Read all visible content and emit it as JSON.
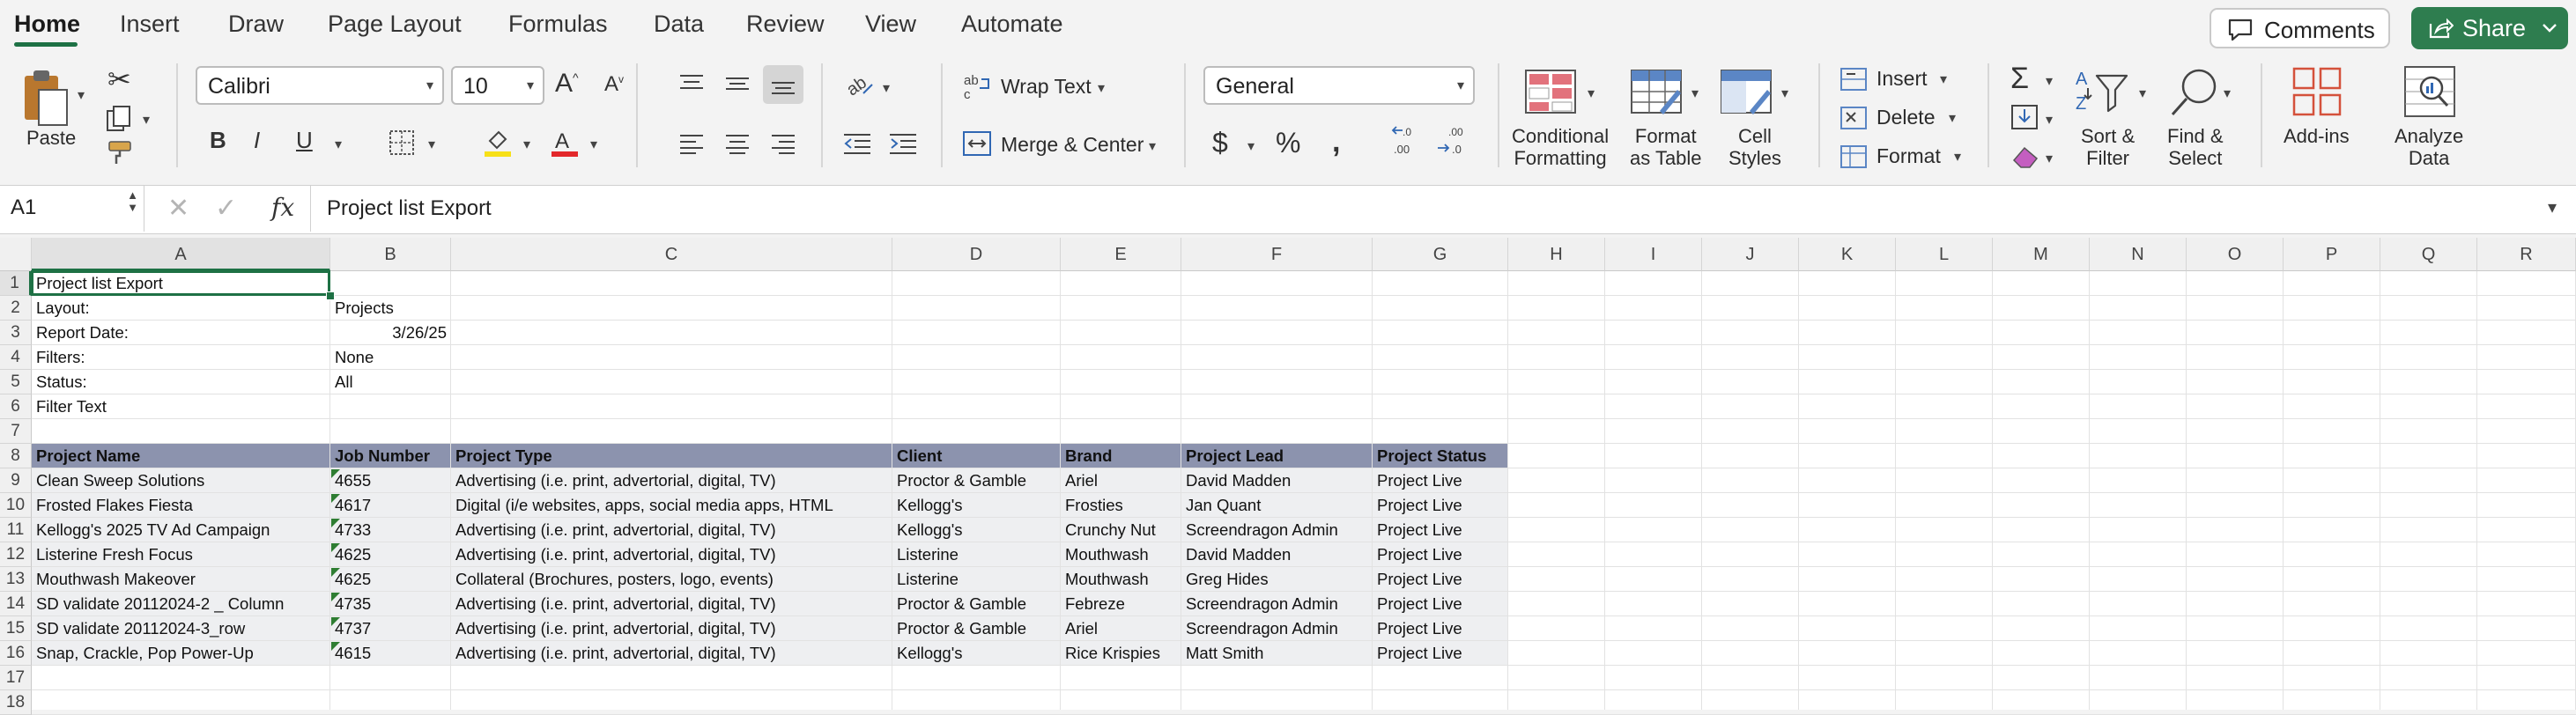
{
  "tabs": [
    {
      "label": "Home",
      "active": true
    },
    {
      "label": "Insert"
    },
    {
      "label": "Draw"
    },
    {
      "label": "Page Layout"
    },
    {
      "label": "Formulas"
    },
    {
      "label": "Data"
    },
    {
      "label": "Review"
    },
    {
      "label": "View"
    },
    {
      "label": "Automate"
    }
  ],
  "top_actions": {
    "comments": "Comments",
    "share": "Share"
  },
  "ribbon": {
    "paste": "Paste",
    "font_name": "Calibri",
    "font_size": "10",
    "wrap_text": "Wrap Text",
    "merge_center": "Merge & Center",
    "number_format": "General",
    "conditional_formatting": [
      "Conditional",
      "Formatting"
    ],
    "format_as_table": [
      "Format",
      "as Table"
    ],
    "cell_styles": [
      "Cell",
      "Styles"
    ],
    "insert": "Insert",
    "delete": "Delete",
    "format": "Format",
    "sort_filter": [
      "Sort &",
      "Filter"
    ],
    "find_select": [
      "Find &",
      "Select"
    ],
    "addins": "Add-ins",
    "analyze_data": [
      "Analyze",
      "Data"
    ],
    "bold": "B",
    "italic": "I",
    "underline": "U",
    "dec_inc": ".0→.00",
    "dec_dec": ".00→.0"
  },
  "formula_bar": {
    "cell_ref": "A1",
    "fx": "fx",
    "content": "Project list Export"
  },
  "columns": [
    "A",
    "B",
    "C",
    "D",
    "E",
    "F",
    "G",
    "H",
    "I",
    "J",
    "K",
    "L",
    "M",
    "N",
    "O",
    "P",
    "Q",
    "R"
  ],
  "rows": [
    "1",
    "2",
    "3",
    "4",
    "5",
    "6",
    "7",
    "8",
    "9",
    "10",
    "11",
    "12",
    "13",
    "14",
    "15",
    "16",
    "17",
    "18"
  ],
  "meta": [
    {
      "a": "Project list Export",
      "b": ""
    },
    {
      "a": "Layout:",
      "b": "Projects"
    },
    {
      "a": "Report Date:",
      "b": "3/26/25"
    },
    {
      "a": "Filters:",
      "b": "None"
    },
    {
      "a": "Status:",
      "b": "All"
    },
    {
      "a": "Filter Text",
      "b": ""
    }
  ],
  "table": {
    "headers": [
      "Project Name",
      "Job Number",
      "Project Type",
      "Client",
      "Brand",
      "Project Lead",
      "Project Status"
    ],
    "rows": [
      [
        "Clean Sweep Solutions",
        "4655",
        "Advertising (i.e. print, advertorial, digital, TV)",
        "Proctor & Gamble",
        "Ariel",
        "David Madden",
        "Project Live"
      ],
      [
        "Frosted Flakes Fiesta",
        "4617",
        "Digital (i/e websites, apps, social media apps, HTML",
        "Kellogg's",
        "Frosties",
        "Jan Quant",
        "Project Live"
      ],
      [
        "Kellogg's 2025 TV Ad Campaign",
        "4733",
        "Advertising (i.e. print, advertorial, digital, TV)",
        "Kellogg's",
        "Crunchy Nut",
        "Screendragon Admin",
        "Project Live"
      ],
      [
        "Listerine Fresh Focus",
        "4625",
        "Advertising (i.e. print, advertorial, digital, TV)",
        "Listerine",
        "Mouthwash",
        "David Madden",
        "Project Live"
      ],
      [
        "Mouthwash Makeover",
        "4625",
        "Collateral (Brochures, posters, logo, events)",
        "Listerine",
        "Mouthwash",
        "Greg Hides",
        "Project Live"
      ],
      [
        "SD validate 20112024-2 _ Column",
        "4735",
        "Advertising (i.e. print, advertorial, digital, TV)",
        "Proctor & Gamble",
        "Febreze",
        "Screendragon Admin",
        "Project Live"
      ],
      [
        "SD validate 20112024-3_row",
        "4737",
        "Advertising (i.e. print, advertorial, digital, TV)",
        "Proctor & Gamble",
        "Ariel",
        "Screendragon Admin",
        "Project Live"
      ],
      [
        "Snap, Crackle, Pop Power-Up",
        "4615",
        "Advertising (i.e. print, advertorial, digital, TV)",
        "Kellogg's",
        "Rice Krispies",
        "Matt Smith",
        "Project Live"
      ]
    ]
  },
  "colors": {
    "accent": "#1e7145",
    "share": "#2e7d4f",
    "header_band": "#8c93ae",
    "row_band": "#eeeff1"
  }
}
